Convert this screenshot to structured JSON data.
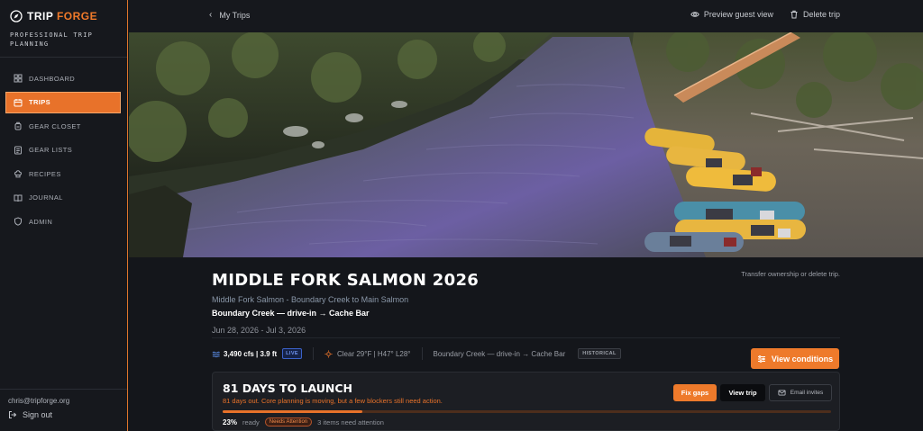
{
  "brand": {
    "name_part1": "TRIP",
    "name_part2": "FORGE",
    "tagline": "PROFESSIONAL TRIP PLANNING"
  },
  "sidebar": {
    "items": [
      {
        "label": "DASHBOARD",
        "icon": "grid-icon",
        "active": false
      },
      {
        "label": "TRIPS",
        "icon": "calendar-icon",
        "active": true
      },
      {
        "label": "GEAR CLOSET",
        "icon": "backpack-icon",
        "active": false
      },
      {
        "label": "GEAR LISTS",
        "icon": "list-icon",
        "active": false
      },
      {
        "label": "RECIPES",
        "icon": "chef-hat-icon",
        "active": false
      },
      {
        "label": "JOURNAL",
        "icon": "book-icon",
        "active": false
      },
      {
        "label": "ADMIN",
        "icon": "shield-icon",
        "active": false
      }
    ],
    "user_email": "chris@tripforge.org",
    "signout_label": "Sign out"
  },
  "topbar": {
    "back_label": "My Trips",
    "preview_label": "Preview guest view",
    "delete_label": "Delete trip"
  },
  "trip": {
    "title": "MIDDLE FORK SALMON 2026",
    "transfer_label": "Transfer ownership or delete trip.",
    "subtitle": "Middle Fork Salmon - Boundary Creek to Main Salmon",
    "route": "Boundary Creek — drive-in → Cache Bar",
    "dates": "Jun 28, 2026 - Jul 3, 2026"
  },
  "conditions": {
    "flow": "3,490 cfs | 3.9 ft",
    "live_badge": "LIVE",
    "weather": "Clear 29°F | H47° L28°",
    "put_in": "Boundary Creek — drive-in → Cache Bar",
    "historical_badge": "HISTORICAL",
    "view_button": "View conditions"
  },
  "launch": {
    "title": "81 DAYS TO LAUNCH",
    "subtitle": "81 days out. Core planning is moving, but a few blockers still need action.",
    "fix_button": "Fix gaps",
    "view_button": "View trip",
    "email_button": "Email invites",
    "progress_percent": 23,
    "percent_label": "23%",
    "ready_label": "ready",
    "needs_badge": "Needs Attention",
    "attention_text": "3 items need attention"
  },
  "colors": {
    "accent": "#e8722a",
    "sidebar_bg": "#16181d",
    "live_blue": "#6f94f0"
  }
}
